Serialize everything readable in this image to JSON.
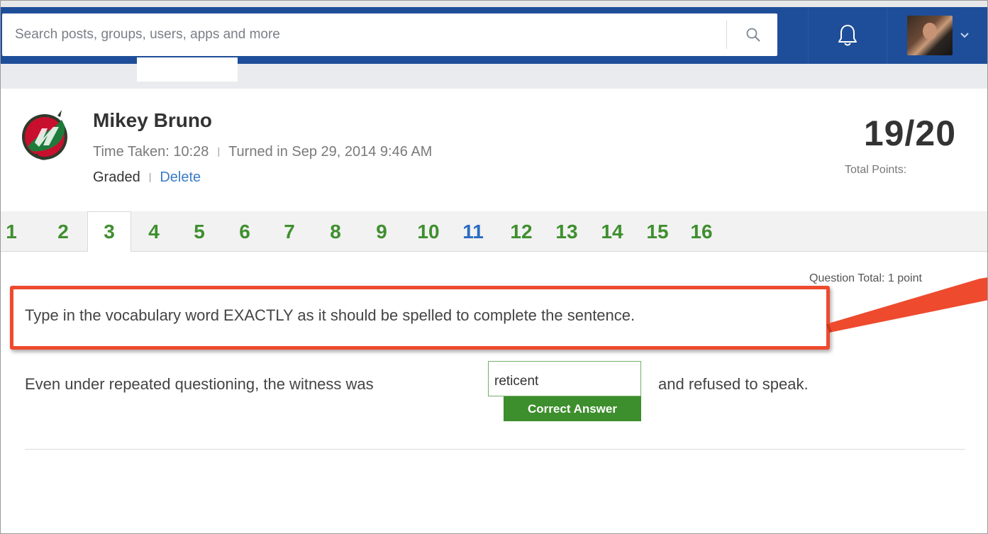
{
  "topbar": {
    "search_placeholder": "Search posts, groups, users, apps and more",
    "search_icon": "search-icon",
    "notification_icon": "bell-icon",
    "profile_icon": "avatar",
    "dropdown_icon": "chevron-down-icon"
  },
  "submission": {
    "student_name": "Mikey Bruno",
    "time_taken": "Time Taken: 10:28",
    "turned_in": "Turned in Sep 29, 2014 9:46 AM",
    "status": "Graded",
    "delete_label": "Delete",
    "score": "19/20",
    "score_label": "Total Points:"
  },
  "tabs": [
    {
      "label": "1",
      "state": "correct"
    },
    {
      "label": "2",
      "state": "correct"
    },
    {
      "label": "3",
      "state": "active"
    },
    {
      "label": "4",
      "state": "correct"
    },
    {
      "label": "5",
      "state": "correct"
    },
    {
      "label": "6",
      "state": "correct"
    },
    {
      "label": "7",
      "state": "correct"
    },
    {
      "label": "8",
      "state": "correct"
    },
    {
      "label": "9",
      "state": "correct"
    },
    {
      "label": "10",
      "state": "correct"
    },
    {
      "label": "11",
      "state": "other"
    },
    {
      "label": "12",
      "state": "correct"
    },
    {
      "label": "13",
      "state": "correct"
    },
    {
      "label": "14",
      "state": "correct"
    },
    {
      "label": "15",
      "state": "correct"
    },
    {
      "label": "16",
      "state": "correct"
    }
  ],
  "question": {
    "total": "Question Total: 1 point",
    "prompt": "Type in the vocabulary word EXACTLY as it should be spelled to complete the sentence.",
    "sentence_before": "Even under repeated questioning, the witness was",
    "answer_value": "reticent",
    "sentence_after": "and refused to speak.",
    "feedback": "Correct Answer"
  },
  "colors": {
    "header_blue": "#1e4e99",
    "correct_green": "#3d8e2c",
    "tab_green": "#3f8f2f",
    "tab_blue": "#2b6cc4",
    "highlight_red": "#ee4a2e",
    "link_blue": "#3a7bc8"
  }
}
